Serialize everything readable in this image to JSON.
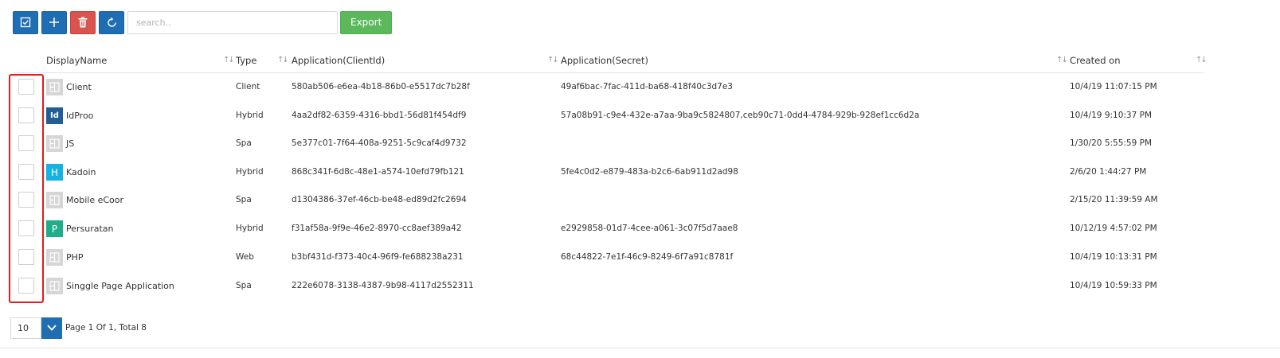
{
  "toolbar": {
    "buttons": [
      {
        "name": "select-all-button",
        "icon": "check-square-icon",
        "color": "#1f6db3"
      },
      {
        "name": "add-button",
        "icon": "plus-icon",
        "color": "#1f6db3"
      },
      {
        "name": "delete-button",
        "icon": "trash-icon",
        "color": "#d9534f"
      },
      {
        "name": "refresh-button",
        "icon": "refresh-icon",
        "color": "#1f6db3"
      }
    ],
    "search_placeholder": "search..",
    "export_label": "Export",
    "export_color": "#5cb85c"
  },
  "table": {
    "columns": [
      "DisplayName",
      "Type",
      "Application(ClientId)",
      "Application(Secret)",
      "Created on"
    ],
    "rows": [
      {
        "logo": "grid-icon",
        "logo_text": "",
        "logo_style": "grey",
        "name": "Client",
        "type": "Client",
        "client_id": "580ab506-e6ea-4b18-86b0-e5517dc7b28f",
        "secret": "49af6bac-7fac-411d-ba68-418f40c3d7e3",
        "created": "10/4/19 11:07:15 PM"
      },
      {
        "logo": "idproo-logo",
        "logo_text": "Id",
        "logo_style": "navy",
        "name": "IdProo",
        "type": "Hybrid",
        "client_id": "4aa2df82-6359-4316-bbd1-56d81f454df9",
        "secret": "57a08b91-c9e4-432e-a7aa-9ba9c5824807,ceb90c71-0dd4-4784-929b-928ef1cc6d2a",
        "created": "10/4/19 9:10:37 PM"
      },
      {
        "logo": "grid-icon",
        "logo_text": "",
        "logo_style": "grey",
        "name": "JS",
        "type": "Spa",
        "client_id": "5e377c01-7f64-408a-9251-5c9caf4d9732",
        "secret": "",
        "created": "1/30/20 5:55:59 PM"
      },
      {
        "logo": "kadoin-logo",
        "logo_text": "H",
        "logo_style": "cyan",
        "name": "Kadoin",
        "type": "Hybrid",
        "client_id": "868c341f-6d8c-48e1-a574-10efd79fb121",
        "secret": "5fe4c0d2-e879-483a-b2c6-6ab911d2ad98",
        "created": "2/6/20 1:44:27 PM"
      },
      {
        "logo": "grid-icon",
        "logo_text": "",
        "logo_style": "grey",
        "name": "Mobile eCoor",
        "type": "Spa",
        "client_id": "d1304386-37ef-46cb-be48-ed89d2fc2694",
        "secret": "",
        "created": "2/15/20 11:39:59 AM"
      },
      {
        "logo": "persuratan-logo",
        "logo_text": "P",
        "logo_style": "teal",
        "name": "Persuratan",
        "type": "Hybrid",
        "client_id": "f31af58a-9f9e-46e2-8970-cc8aef389a42",
        "secret": "e2929858-01d7-4cee-a061-3c07f5d7aae8",
        "created": "10/12/19 4:57:02 PM"
      },
      {
        "logo": "grid-icon",
        "logo_text": "",
        "logo_style": "grey",
        "name": "PHP",
        "type": "Web",
        "client_id": "b3bf431d-f373-40c4-96f9-fe688238a231",
        "secret": "68c44822-7e1f-46c9-8249-6f7a91c8781f",
        "created": "10/4/19 10:13:31 PM"
      },
      {
        "logo": "grid-icon",
        "logo_text": "",
        "logo_style": "grey",
        "name": "Singgle Page Application",
        "type": "Spa",
        "client_id": "222e6078-3138-4387-9b98-4117d2552311",
        "secret": "",
        "created": "10/4/19 10:59:33 PM"
      }
    ]
  },
  "pager": {
    "page_size": "10",
    "info": "Page 1 Of 1, Total 8"
  },
  "highlight_color": "#e21b1b"
}
